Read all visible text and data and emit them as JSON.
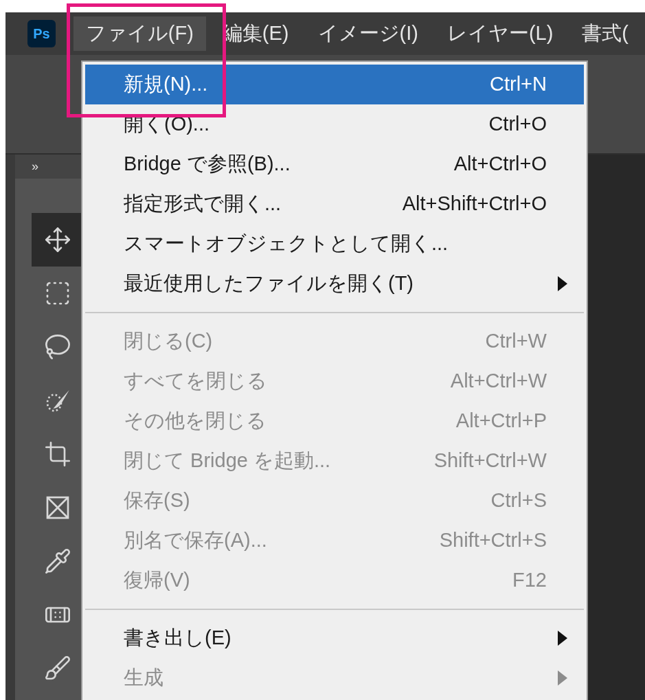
{
  "menubar": {
    "logo": "Ps",
    "items": [
      {
        "label": "ファイル(F)",
        "selected": true
      },
      {
        "label": "編集(E)",
        "selected": false
      },
      {
        "label": "イメージ(I)",
        "selected": false
      },
      {
        "label": "レイヤー(L)",
        "selected": false
      },
      {
        "label": "書式(",
        "selected": false
      }
    ]
  },
  "panel": {
    "collapse": "»"
  },
  "tools": [
    {
      "kind": "move",
      "selected": true
    },
    {
      "kind": "marquee",
      "selected": false
    },
    {
      "kind": "lasso",
      "selected": false
    },
    {
      "kind": "quick-select",
      "selected": false
    },
    {
      "kind": "crop",
      "selected": false
    },
    {
      "kind": "frame",
      "selected": false
    },
    {
      "kind": "eyedropper",
      "selected": false
    },
    {
      "kind": "healing",
      "selected": false
    },
    {
      "kind": "brush",
      "selected": false
    }
  ],
  "file_menu": [
    {
      "kind": "item",
      "label": "新規(N)...",
      "shortcut": "Ctrl+N",
      "disabled": false,
      "selected": true,
      "submenu": false
    },
    {
      "kind": "item",
      "label": "開く(O)...",
      "shortcut": "Ctrl+O",
      "disabled": false,
      "selected": false,
      "submenu": false
    },
    {
      "kind": "item",
      "label": "Bridge で参照(B)...",
      "shortcut": "Alt+Ctrl+O",
      "disabled": false,
      "selected": false,
      "submenu": false
    },
    {
      "kind": "item",
      "label": "指定形式で開く...",
      "shortcut": "Alt+Shift+Ctrl+O",
      "disabled": false,
      "selected": false,
      "submenu": false
    },
    {
      "kind": "item",
      "label": "スマートオブジェクトとして開く...",
      "disabled": false,
      "selected": false,
      "submenu": false
    },
    {
      "kind": "item",
      "label": "最近使用したファイルを開く(T)",
      "disabled": false,
      "selected": false,
      "submenu": true
    },
    {
      "kind": "separator"
    },
    {
      "kind": "item",
      "label": "閉じる(C)",
      "shortcut": "Ctrl+W",
      "disabled": true,
      "selected": false,
      "submenu": false
    },
    {
      "kind": "item",
      "label": "すべてを閉じる",
      "shortcut": "Alt+Ctrl+W",
      "disabled": true,
      "selected": false,
      "submenu": false
    },
    {
      "kind": "item",
      "label": "その他を閉じる",
      "shortcut": "Alt+Ctrl+P",
      "disabled": true,
      "selected": false,
      "submenu": false
    },
    {
      "kind": "item",
      "label": "閉じて Bridge を起動...",
      "shortcut": "Shift+Ctrl+W",
      "disabled": true,
      "selected": false,
      "submenu": false
    },
    {
      "kind": "item",
      "label": "保存(S)",
      "shortcut": "Ctrl+S",
      "disabled": true,
      "selected": false,
      "submenu": false
    },
    {
      "kind": "item",
      "label": "別名で保存(A)...",
      "shortcut": "Shift+Ctrl+S",
      "disabled": true,
      "selected": false,
      "submenu": false
    },
    {
      "kind": "item",
      "label": "復帰(V)",
      "shortcut": "F12",
      "disabled": true,
      "selected": false,
      "submenu": false
    },
    {
      "kind": "separator"
    },
    {
      "kind": "item",
      "label": "書き出し(E)",
      "disabled": false,
      "selected": false,
      "submenu": true
    },
    {
      "kind": "item",
      "label": "生成",
      "disabled": true,
      "selected": false,
      "submenu": true
    }
  ]
}
